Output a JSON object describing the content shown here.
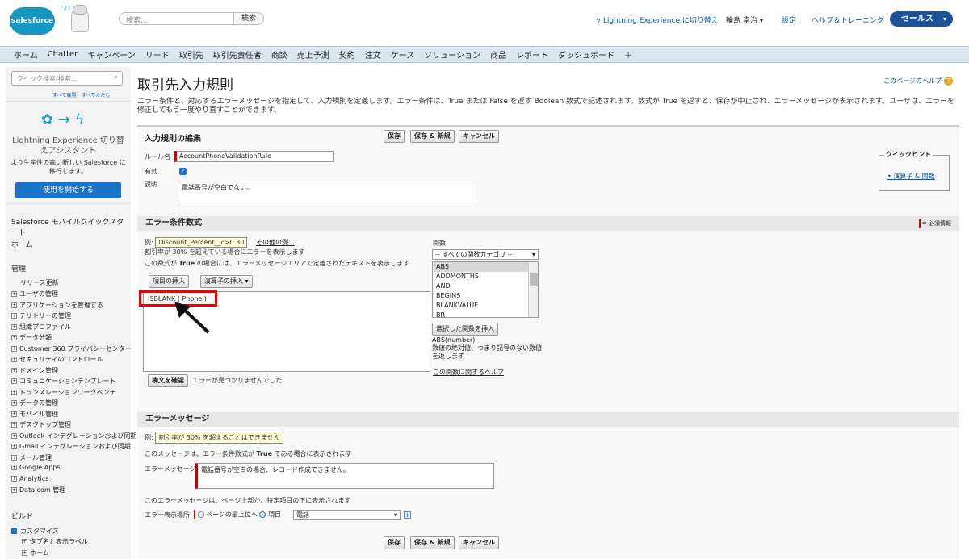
{
  "header": {
    "logo": "salesforce",
    "year": "'21",
    "search_placeholder": "検索...",
    "search_button": "検索",
    "switch_link": "Lightning Experience に切り替え",
    "user": "輪島 幸治 ▾",
    "setup": "設定",
    "help": "ヘルプ＆トレーニング",
    "app_menu": "セールス"
  },
  "tabs": [
    "ホーム",
    "Chatter",
    "キャンペーン",
    "リード",
    "取引先",
    "取引先責任者",
    "商談",
    "売上予測",
    "契約",
    "注文",
    "ケース",
    "ソリューション",
    "商品",
    "レポート",
    "ダッシュボード",
    "＋"
  ],
  "sidebar": {
    "quick_search_placeholder": "クイック検索/検索...",
    "expand_all": "すべて展開",
    "collapse_all": "すべてたたむ",
    "lex_title": "Lightning Experience 切り替えアシスタント",
    "lex_sub": "より生産性の高い新しい Salesforce に移行します。",
    "lex_button": "使用を開始する",
    "mobile": "Salesforce モバイルクイックスタート",
    "home": "ホーム",
    "admin": "管理",
    "release": "リリース更新",
    "admin_items": [
      "ユーザの管理",
      "アプリケーションを管理する",
      "テリトリーの管理",
      "組織プロファイル",
      "データ分類",
      "Customer 360 プライバシーセンター",
      "セキュリティのコントロール",
      "ドメイン管理",
      "コミュニケーションテンプレート",
      "トランスレーションワークベンチ",
      "データの管理",
      "モバイル管理",
      "デスクトップ管理",
      "Outlook インテグレーションおよび同期",
      "Gmail インテグレーションおよび同期",
      "メール管理",
      "Google Apps",
      "Analytics",
      "Data.com 管理"
    ],
    "build": "ビルド",
    "customize": "カスタマイズ",
    "customize_items": [
      "タブ名と表示ラベル",
      "ホーム"
    ]
  },
  "main": {
    "title": "取引先入力規則",
    "help_link": "このページのヘルプ",
    "description": "エラー条件と、対応するエラーメッセージを指定して、入力規則を定義します。エラー条件は、True または False を返す Boolean 数式で記述されます。数式が True を返すと、保存が中止され、エラーメッセージが表示されます。ユーザは、エラーを修正してもう一度やり直すことができます。",
    "edit_section": "入力規則の編集",
    "save": "保存",
    "save_new": "保存 & 新規",
    "cancel": "キャンセル",
    "rule_name_label": "ルール名",
    "rule_name": "AccountPhoneValidationRule",
    "active_label": "有効",
    "active_check": "✓",
    "desc_label": "説明",
    "desc_value": "電話番号が空白でない。",
    "quick_hint": "クイックヒント",
    "hint_item": "演算子 & 関数",
    "error_cond_section": "エラー条件数式",
    "required_info": "= 必須情報",
    "example_label": "例:",
    "example_formula": "Discount_Percent__c>0.30",
    "more_examples": "その他の例...",
    "example_desc": "割引率が 30% を超えている場合にエラーを表示します",
    "formula_hint_pre": "この数式が ",
    "formula_hint_true": "True",
    "formula_hint_post": " の場合には、エラーメッセージエリアで定義されたテキストを表示します",
    "insert_field": "項目の挿入",
    "insert_operator": "演算子の挿入 ▾",
    "formula": "ISBLANK ( Phone )",
    "check_syntax": "構文を確認",
    "no_errors": "エラーが見つかりませんでした",
    "functions_label": "関数",
    "function_category": "-- すべての関数カテゴリ --",
    "functions": [
      "ABS",
      "ADDMONTHS",
      "AND",
      "BEGINS",
      "BLANKVALUE",
      "BR"
    ],
    "insert_function": "選択した関数を挿入",
    "function_sig": "ABS(number)",
    "function_desc": "数値の絶対値、つまり記号のない数値を返します",
    "function_help": "この関数に関するヘルプ",
    "error_msg_section": "エラーメッセージ",
    "msg_example": "割引率が 30% を超えることはできません",
    "msg_hint_pre": "このメッセージは、エラー条件数式が ",
    "msg_hint_post": " である場合に表示されます",
    "error_msg_label": "エラーメッセージ",
    "error_msg": "電話番号が空白の場合、レコード作成できません。",
    "loc_hint": "このエラーメッセージは、ページ上部か、特定項目の下に表示されます",
    "loc_label": "エラー表示場所",
    "loc_top": "ページの最上位へ",
    "loc_field": "項目",
    "loc_select": "電話",
    "info": "i"
  }
}
